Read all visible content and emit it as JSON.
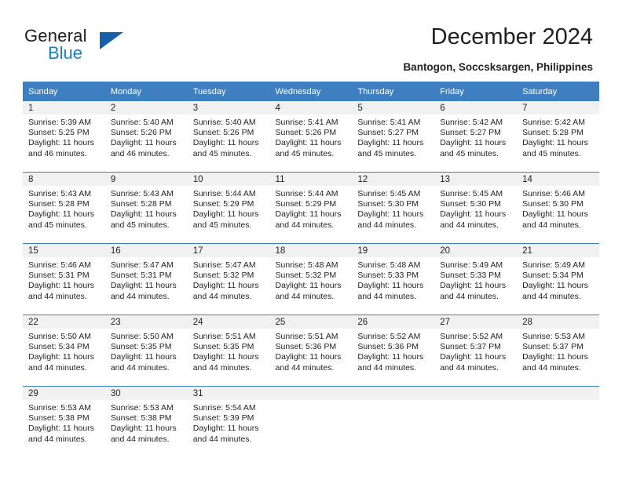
{
  "brand": {
    "name_top": "General",
    "name_bottom": "Blue"
  },
  "header": {
    "title": "December 2024",
    "subtitle": "Bantogon, Soccsksargen, Philippines"
  },
  "colors": {
    "header_blue": "#3d7fc1",
    "brand_blue": "#1a7fc1",
    "band_gray": "#f1f1f1",
    "text": "#231f20"
  },
  "calendar": {
    "weekday_headers": [
      "Sunday",
      "Monday",
      "Tuesday",
      "Wednesday",
      "Thursday",
      "Friday",
      "Saturday"
    ],
    "weeks": [
      [
        {
          "day": "1",
          "sunrise": "Sunrise: 5:39 AM",
          "sunset": "Sunset: 5:25 PM",
          "daylight_1": "Daylight: 11 hours",
          "daylight_2": "and 46 minutes."
        },
        {
          "day": "2",
          "sunrise": "Sunrise: 5:40 AM",
          "sunset": "Sunset: 5:26 PM",
          "daylight_1": "Daylight: 11 hours",
          "daylight_2": "and 46 minutes."
        },
        {
          "day": "3",
          "sunrise": "Sunrise: 5:40 AM",
          "sunset": "Sunset: 5:26 PM",
          "daylight_1": "Daylight: 11 hours",
          "daylight_2": "and 45 minutes."
        },
        {
          "day": "4",
          "sunrise": "Sunrise: 5:41 AM",
          "sunset": "Sunset: 5:26 PM",
          "daylight_1": "Daylight: 11 hours",
          "daylight_2": "and 45 minutes."
        },
        {
          "day": "5",
          "sunrise": "Sunrise: 5:41 AM",
          "sunset": "Sunset: 5:27 PM",
          "daylight_1": "Daylight: 11 hours",
          "daylight_2": "and 45 minutes."
        },
        {
          "day": "6",
          "sunrise": "Sunrise: 5:42 AM",
          "sunset": "Sunset: 5:27 PM",
          "daylight_1": "Daylight: 11 hours",
          "daylight_2": "and 45 minutes."
        },
        {
          "day": "7",
          "sunrise": "Sunrise: 5:42 AM",
          "sunset": "Sunset: 5:28 PM",
          "daylight_1": "Daylight: 11 hours",
          "daylight_2": "and 45 minutes."
        }
      ],
      [
        {
          "day": "8",
          "sunrise": "Sunrise: 5:43 AM",
          "sunset": "Sunset: 5:28 PM",
          "daylight_1": "Daylight: 11 hours",
          "daylight_2": "and 45 minutes."
        },
        {
          "day": "9",
          "sunrise": "Sunrise: 5:43 AM",
          "sunset": "Sunset: 5:28 PM",
          "daylight_1": "Daylight: 11 hours",
          "daylight_2": "and 45 minutes."
        },
        {
          "day": "10",
          "sunrise": "Sunrise: 5:44 AM",
          "sunset": "Sunset: 5:29 PM",
          "daylight_1": "Daylight: 11 hours",
          "daylight_2": "and 45 minutes."
        },
        {
          "day": "11",
          "sunrise": "Sunrise: 5:44 AM",
          "sunset": "Sunset: 5:29 PM",
          "daylight_1": "Daylight: 11 hours",
          "daylight_2": "and 44 minutes."
        },
        {
          "day": "12",
          "sunrise": "Sunrise: 5:45 AM",
          "sunset": "Sunset: 5:30 PM",
          "daylight_1": "Daylight: 11 hours",
          "daylight_2": "and 44 minutes."
        },
        {
          "day": "13",
          "sunrise": "Sunrise: 5:45 AM",
          "sunset": "Sunset: 5:30 PM",
          "daylight_1": "Daylight: 11 hours",
          "daylight_2": "and 44 minutes."
        },
        {
          "day": "14",
          "sunrise": "Sunrise: 5:46 AM",
          "sunset": "Sunset: 5:30 PM",
          "daylight_1": "Daylight: 11 hours",
          "daylight_2": "and 44 minutes."
        }
      ],
      [
        {
          "day": "15",
          "sunrise": "Sunrise: 5:46 AM",
          "sunset": "Sunset: 5:31 PM",
          "daylight_1": "Daylight: 11 hours",
          "daylight_2": "and 44 minutes."
        },
        {
          "day": "16",
          "sunrise": "Sunrise: 5:47 AM",
          "sunset": "Sunset: 5:31 PM",
          "daylight_1": "Daylight: 11 hours",
          "daylight_2": "and 44 minutes."
        },
        {
          "day": "17",
          "sunrise": "Sunrise: 5:47 AM",
          "sunset": "Sunset: 5:32 PM",
          "daylight_1": "Daylight: 11 hours",
          "daylight_2": "and 44 minutes."
        },
        {
          "day": "18",
          "sunrise": "Sunrise: 5:48 AM",
          "sunset": "Sunset: 5:32 PM",
          "daylight_1": "Daylight: 11 hours",
          "daylight_2": "and 44 minutes."
        },
        {
          "day": "19",
          "sunrise": "Sunrise: 5:48 AM",
          "sunset": "Sunset: 5:33 PM",
          "daylight_1": "Daylight: 11 hours",
          "daylight_2": "and 44 minutes."
        },
        {
          "day": "20",
          "sunrise": "Sunrise: 5:49 AM",
          "sunset": "Sunset: 5:33 PM",
          "daylight_1": "Daylight: 11 hours",
          "daylight_2": "and 44 minutes."
        },
        {
          "day": "21",
          "sunrise": "Sunrise: 5:49 AM",
          "sunset": "Sunset: 5:34 PM",
          "daylight_1": "Daylight: 11 hours",
          "daylight_2": "and 44 minutes."
        }
      ],
      [
        {
          "day": "22",
          "sunrise": "Sunrise: 5:50 AM",
          "sunset": "Sunset: 5:34 PM",
          "daylight_1": "Daylight: 11 hours",
          "daylight_2": "and 44 minutes."
        },
        {
          "day": "23",
          "sunrise": "Sunrise: 5:50 AM",
          "sunset": "Sunset: 5:35 PM",
          "daylight_1": "Daylight: 11 hours",
          "daylight_2": "and 44 minutes."
        },
        {
          "day": "24",
          "sunrise": "Sunrise: 5:51 AM",
          "sunset": "Sunset: 5:35 PM",
          "daylight_1": "Daylight: 11 hours",
          "daylight_2": "and 44 minutes."
        },
        {
          "day": "25",
          "sunrise": "Sunrise: 5:51 AM",
          "sunset": "Sunset: 5:36 PM",
          "daylight_1": "Daylight: 11 hours",
          "daylight_2": "and 44 minutes."
        },
        {
          "day": "26",
          "sunrise": "Sunrise: 5:52 AM",
          "sunset": "Sunset: 5:36 PM",
          "daylight_1": "Daylight: 11 hours",
          "daylight_2": "and 44 minutes."
        },
        {
          "day": "27",
          "sunrise": "Sunrise: 5:52 AM",
          "sunset": "Sunset: 5:37 PM",
          "daylight_1": "Daylight: 11 hours",
          "daylight_2": "and 44 minutes."
        },
        {
          "day": "28",
          "sunrise": "Sunrise: 5:53 AM",
          "sunset": "Sunset: 5:37 PM",
          "daylight_1": "Daylight: 11 hours",
          "daylight_2": "and 44 minutes."
        }
      ],
      [
        {
          "day": "29",
          "sunrise": "Sunrise: 5:53 AM",
          "sunset": "Sunset: 5:38 PM",
          "daylight_1": "Daylight: 11 hours",
          "daylight_2": "and 44 minutes."
        },
        {
          "day": "30",
          "sunrise": "Sunrise: 5:53 AM",
          "sunset": "Sunset: 5:38 PM",
          "daylight_1": "Daylight: 11 hours",
          "daylight_2": "and 44 minutes."
        },
        {
          "day": "31",
          "sunrise": "Sunrise: 5:54 AM",
          "sunset": "Sunset: 5:39 PM",
          "daylight_1": "Daylight: 11 hours",
          "daylight_2": "and 44 minutes."
        },
        {
          "day": "",
          "sunrise": "",
          "sunset": "",
          "daylight_1": "",
          "daylight_2": ""
        },
        {
          "day": "",
          "sunrise": "",
          "sunset": "",
          "daylight_1": "",
          "daylight_2": ""
        },
        {
          "day": "",
          "sunrise": "",
          "sunset": "",
          "daylight_1": "",
          "daylight_2": ""
        },
        {
          "day": "",
          "sunrise": "",
          "sunset": "",
          "daylight_1": "",
          "daylight_2": ""
        }
      ]
    ]
  }
}
